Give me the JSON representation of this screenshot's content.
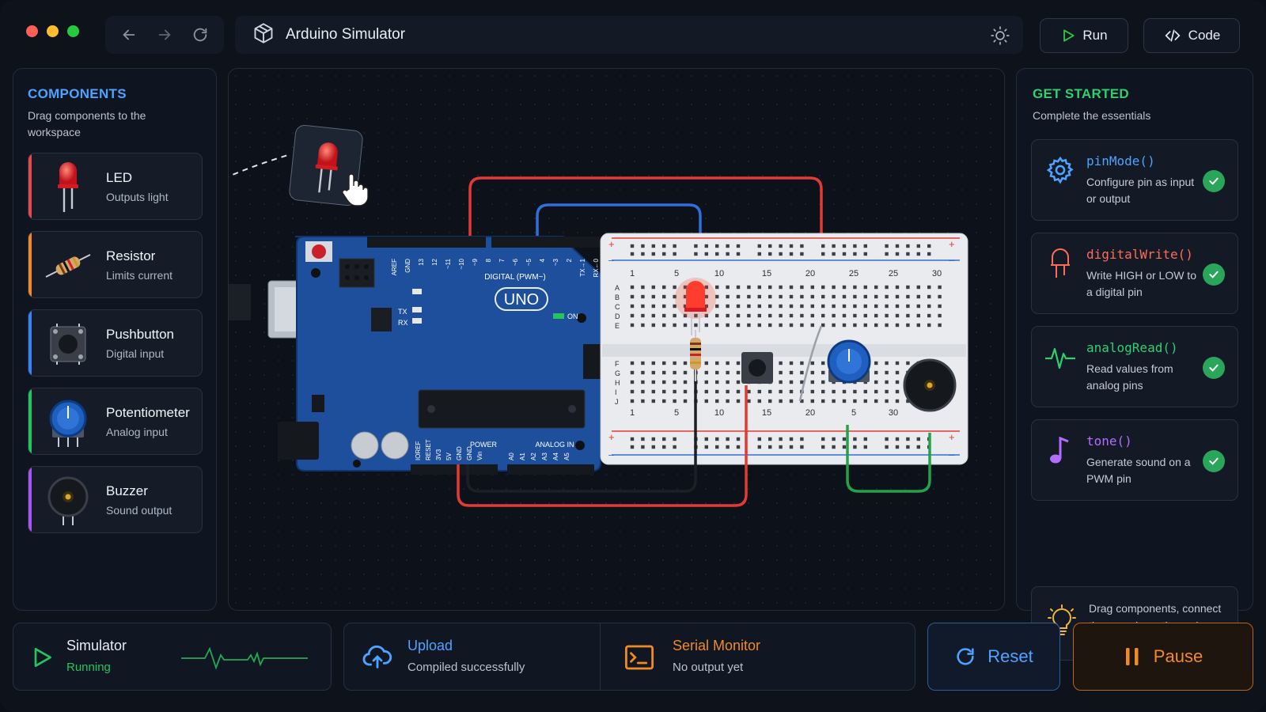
{
  "titlebar": {
    "traffic_lights": {
      "close": "#ff5f57",
      "minimize": "#febc2e",
      "maximize": "#28c840"
    },
    "app_icon": "cube-icon",
    "title": "Arduino Simulator",
    "theme_icon": "sun-icon"
  },
  "toolbar": {
    "run_label": "Run",
    "code_label": "Code"
  },
  "components": {
    "heading": "COMPONENTS",
    "subtitle": "Drag components to the workspace",
    "items": [
      {
        "name": "LED",
        "desc": "Outputs light",
        "accent": "#e5484d",
        "icon": "led-icon"
      },
      {
        "name": "Resistor",
        "desc": "Limits current",
        "accent": "#f08a24",
        "icon": "resistor-icon"
      },
      {
        "name": "Pushbutton",
        "desc": "Digital input",
        "accent": "#3b82f6",
        "icon": "pushbutton-icon"
      },
      {
        "name": "Potentiometer",
        "desc": "Analog input",
        "accent": "#22c55e",
        "icon": "potentiometer-icon"
      },
      {
        "name": "Buzzer",
        "desc": "Sound output",
        "accent": "#a855f7",
        "icon": "buzzer-icon"
      }
    ]
  },
  "board": {
    "label": "UNO",
    "digital_label": "DIGITAL (PWM~)",
    "power_label": "POWER",
    "analog_label": "ANALOG IN",
    "on_label": "ON",
    "tx_label": "TX",
    "rx_label": "RX",
    "top_pins": [
      "AREF",
      "GND",
      "13",
      "12",
      "~11",
      "~10",
      "~9",
      "8",
      "7",
      "~6",
      "~5",
      "4",
      "~3",
      "2",
      "TX→1",
      "RX←0"
    ],
    "power_pins": [
      "IOREF",
      "RESET",
      "3V3",
      "5V",
      "GND",
      "GND",
      "Vin"
    ],
    "analog_pins": [
      "A0",
      "A1",
      "A2",
      "A3",
      "A4",
      "A5"
    ]
  },
  "breadboard": {
    "row_letters_top": [
      "A",
      "B",
      "C",
      "D",
      "E"
    ],
    "row_letters_bottom": [
      "F",
      "G",
      "H",
      "I",
      "J"
    ],
    "col_numbers_top": [
      "1",
      "5",
      "10",
      "15",
      "20",
      "25",
      "25",
      "30"
    ],
    "col_numbers_bottom": [
      "1",
      "5",
      "10",
      "15",
      "20",
      "5",
      "30"
    ]
  },
  "get_started": {
    "heading": "GET STARTED",
    "subtitle": "Complete the essentials",
    "cards": [
      {
        "fn": "pinMode()",
        "desc": "Configure pin as input or output",
        "color": "#4da3ff",
        "icon": "gear-icon",
        "done": true
      },
      {
        "fn": "digitalWrite()",
        "desc": "Write HIGH or LOW to a digital pin",
        "color": "#ff6b57",
        "icon": "led-icon",
        "done": true
      },
      {
        "fn": "analogRead()",
        "desc": "Read values from analog pins",
        "color": "#2ecf6f",
        "icon": "waveform-icon",
        "done": true
      },
      {
        "fn": "tone()",
        "desc": "Generate sound on a PWM pin",
        "color": "#b46cff",
        "icon": "music-note-icon",
        "done": true
      }
    ],
    "tip": "Drag components, connect them, and see the code come to life!"
  },
  "status": {
    "simulator": {
      "title": "Simulator",
      "sub": "Running",
      "color": "#22c55e"
    },
    "upload": {
      "title": "Upload",
      "sub": "Compiled successfully",
      "color": "#4da3ff"
    },
    "serial": {
      "title": "Serial Monitor",
      "sub": "No output yet",
      "color": "#f08a24"
    },
    "reset_label": "Reset",
    "pause_label": "Pause"
  }
}
